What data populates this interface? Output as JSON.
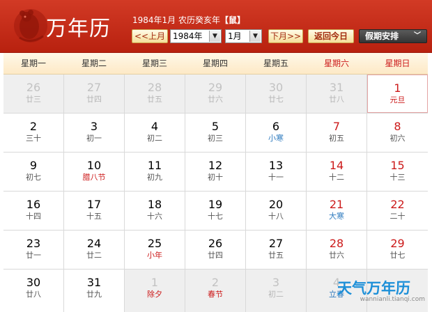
{
  "app": {
    "title": "万年历",
    "date_info": "1984年1月 农历癸亥年",
    "zodiac": "【鼠】",
    "logo_icon": "rat-papercut-icon"
  },
  "controls": {
    "prev_label": "<<上月",
    "year_value": "1984年",
    "month_value": "1月",
    "next_label": "下月>>",
    "today_label": "返回今日",
    "holiday_label": "假期安排"
  },
  "weekdays": [
    {
      "label": "星期一",
      "weekend": false
    },
    {
      "label": "星期二",
      "weekend": false
    },
    {
      "label": "星期三",
      "weekend": false
    },
    {
      "label": "星期四",
      "weekend": false
    },
    {
      "label": "星期五",
      "weekend": false
    },
    {
      "label": "星期六",
      "weekend": true
    },
    {
      "label": "星期日",
      "weekend": true
    }
  ],
  "weeks": [
    [
      {
        "day": "26",
        "lunar": "廿三",
        "muted": true
      },
      {
        "day": "27",
        "lunar": "廿四",
        "muted": true
      },
      {
        "day": "28",
        "lunar": "廿五",
        "muted": true
      },
      {
        "day": "29",
        "lunar": "廿六",
        "muted": true
      },
      {
        "day": "30",
        "lunar": "廿七",
        "muted": true
      },
      {
        "day": "31",
        "lunar": "廿八",
        "muted": true
      },
      {
        "day": "1",
        "lunar": "元旦",
        "kind": "fest",
        "today": true
      }
    ],
    [
      {
        "day": "2",
        "lunar": "三十"
      },
      {
        "day": "3",
        "lunar": "初一"
      },
      {
        "day": "4",
        "lunar": "初二"
      },
      {
        "day": "5",
        "lunar": "初三"
      },
      {
        "day": "6",
        "lunar": "小寒",
        "kind": "term"
      },
      {
        "day": "7",
        "lunar": "初五"
      },
      {
        "day": "8",
        "lunar": "初六"
      }
    ],
    [
      {
        "day": "9",
        "lunar": "初七"
      },
      {
        "day": "10",
        "lunar": "腊八节",
        "kind": "fest"
      },
      {
        "day": "11",
        "lunar": "初九"
      },
      {
        "day": "12",
        "lunar": "初十"
      },
      {
        "day": "13",
        "lunar": "十一"
      },
      {
        "day": "14",
        "lunar": "十二"
      },
      {
        "day": "15",
        "lunar": "十三"
      }
    ],
    [
      {
        "day": "16",
        "lunar": "十四"
      },
      {
        "day": "17",
        "lunar": "十五"
      },
      {
        "day": "18",
        "lunar": "十六"
      },
      {
        "day": "19",
        "lunar": "十七"
      },
      {
        "day": "20",
        "lunar": "十八"
      },
      {
        "day": "21",
        "lunar": "大寒",
        "kind": "term"
      },
      {
        "day": "22",
        "lunar": "二十"
      }
    ],
    [
      {
        "day": "23",
        "lunar": "廿一"
      },
      {
        "day": "24",
        "lunar": "廿二"
      },
      {
        "day": "25",
        "lunar": "小年",
        "kind": "fest"
      },
      {
        "day": "26",
        "lunar": "廿四"
      },
      {
        "day": "27",
        "lunar": "廿五"
      },
      {
        "day": "28",
        "lunar": "廿六"
      },
      {
        "day": "29",
        "lunar": "廿七"
      }
    ],
    [
      {
        "day": "30",
        "lunar": "廿八"
      },
      {
        "day": "31",
        "lunar": "廿九"
      },
      {
        "day": "1",
        "lunar": "除夕",
        "kind": "fest",
        "muted": true
      },
      {
        "day": "2",
        "lunar": "春节",
        "kind": "fest",
        "muted": true
      },
      {
        "day": "3",
        "lunar": "初二",
        "muted": true
      },
      {
        "day": "4",
        "lunar": "立春",
        "kind": "term",
        "muted": true
      },
      {
        "day": "",
        "lunar": "",
        "muted": true
      }
    ]
  ],
  "watermark": {
    "title": "天气万年历",
    "url": "wannianli.tianqi.com"
  },
  "colors": {
    "header_red": "#c62d1a",
    "weekend_red": "#cc1a1a",
    "solar_term_blue": "#2f7bbf",
    "watermark_blue": "#1c8fd8"
  }
}
